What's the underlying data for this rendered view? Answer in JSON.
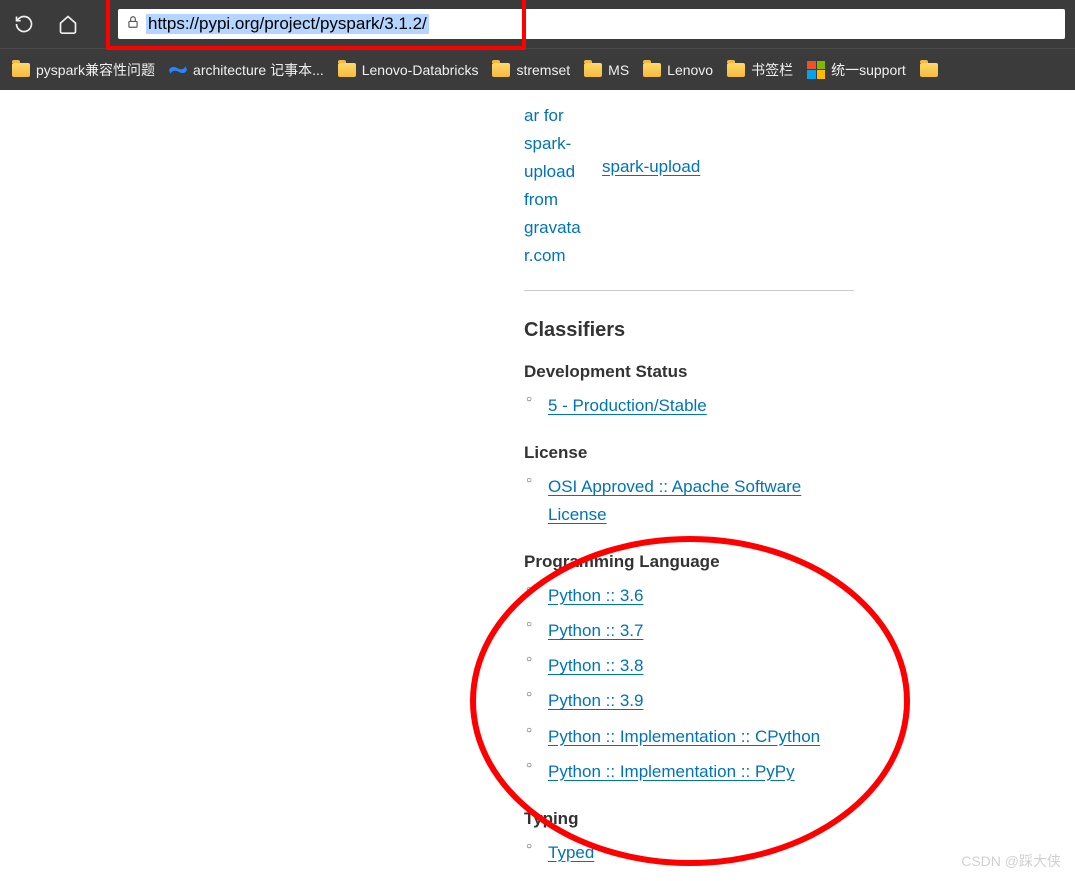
{
  "url": "https://pypi.org/project/pyspark/3.1.2/",
  "bookmarks": [
    {
      "type": "folder",
      "label": "pyspark兼容性问题"
    },
    {
      "type": "confluence",
      "label": "architecture 记事本..."
    },
    {
      "type": "folder",
      "label": "Lenovo-Databricks"
    },
    {
      "type": "folder",
      "label": "stremset"
    },
    {
      "type": "folder",
      "label": "MS"
    },
    {
      "type": "folder",
      "label": "Lenovo"
    },
    {
      "type": "folder",
      "label": "书签栏"
    },
    {
      "type": "ms",
      "label": "统一support"
    }
  ],
  "avatar": {
    "alt_text": "ar for spark-upload from gravatar.com",
    "maintainer": "spark-upload"
  },
  "classifiers": {
    "heading": "Classifiers",
    "groups": [
      {
        "title": "Development Status",
        "items": [
          "5 - Production/Stable"
        ]
      },
      {
        "title": "License",
        "items": [
          "OSI Approved :: Apache Software License"
        ]
      },
      {
        "title": "Programming Language",
        "items": [
          "Python :: 3.6",
          "Python :: 3.7",
          "Python :: 3.8",
          "Python :: 3.9",
          "Python :: Implementation :: CPython",
          "Python :: Implementation :: PyPy"
        ]
      },
      {
        "title": "Typing",
        "items": [
          "Typed"
        ]
      }
    ]
  },
  "watermark": "CSDN @踩大侠"
}
